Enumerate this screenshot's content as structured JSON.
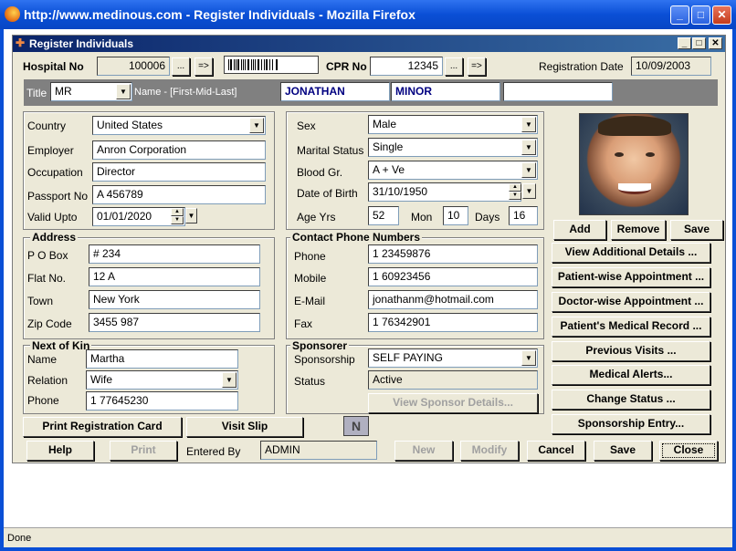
{
  "browser": {
    "title": "http://www.medinous.com - Register Individuals - Mozilla Firefox",
    "minimize": "_",
    "maximize": "□",
    "close": "✕",
    "status": "Done"
  },
  "dialog": {
    "title": "Register Individuals",
    "minimize": "_",
    "maximize": "□",
    "close": "✕"
  },
  "header": {
    "hospital_no_label": "Hospital No",
    "hospital_no": "100006",
    "browse_btn": "...",
    "go_btn": "=>",
    "cpr_no_label": "CPR No",
    "cpr_no": "12345",
    "registration_date_label": "Registration Date",
    "registration_date": "10/09/2003"
  },
  "name_band": {
    "title_label": "Title",
    "title_value": "MR",
    "name_label": "Name - [First-Mid-Last]",
    "first": "JONATHAN",
    "middle": "MINOR",
    "last": ""
  },
  "personal": {
    "country_label": "Country",
    "country": "United States",
    "employer_label": "Employer",
    "employer": "Anron Corporation",
    "occupation_label": "Occupation",
    "occupation": "Director",
    "passport_label": "Passport No",
    "passport": "A 456789",
    "valid_upto_label": "Valid Upto",
    "valid_upto": "01/01/2020"
  },
  "demographics": {
    "sex_label": "Sex",
    "sex": "Male",
    "marital_label": "Marital Status",
    "marital": "Single",
    "blood_label": "Blood Gr.",
    "blood": "A + Ve",
    "dob_label": "Date of Birth",
    "dob": "31/10/1950",
    "age_label": "Age Yrs",
    "age_yrs": "52",
    "mon_label": "Mon",
    "mon": "10",
    "days_label": "Days",
    "days": "16"
  },
  "photo_buttons": {
    "add": "Add",
    "remove": "Remove",
    "save": "Save"
  },
  "address": {
    "title": "Address",
    "pobox_label": "P O Box",
    "pobox": "# 234",
    "flat_label": "Flat No.",
    "flat": "12 A",
    "town_label": "Town",
    "town": "New York",
    "zip_label": "Zip Code",
    "zip": "3455 987"
  },
  "contact": {
    "title": "Contact Phone Numbers",
    "phone_label": "Phone",
    "phone": "1 23459876",
    "mobile_label": "Mobile",
    "mobile": "1 60923456",
    "email_label": "E-Mail",
    "email": "jonathanm@hotmail.com",
    "fax_label": "Fax",
    "fax": "1 76342901"
  },
  "kin": {
    "title": "Next of Kin",
    "name_label": "Name",
    "name": "Martha",
    "relation_label": "Relation",
    "relation": "Wife",
    "phone_label": "Phone",
    "phone": "1 77645230"
  },
  "sponsor": {
    "title": "Sponsorer",
    "sponsorship_label": "Sponsorship",
    "sponsorship": "SELF PAYING",
    "status_label": "Status",
    "status": "Active",
    "view_details": "View Sponsor Details..."
  },
  "side_actions": [
    "View Additional Details ...",
    "Patient-wise Appointment ...",
    "Doctor-wise Appointment ...",
    "Patient's Medical Record ...",
    "Previous Visits ...",
    "Medical Alerts...",
    "Change Status ...",
    "Sponsorship Entry..."
  ],
  "print_row": {
    "print_card": "Print Registration Card",
    "visit_slip": "Visit Slip",
    "notes_icon": "N"
  },
  "footer": {
    "help": "Help",
    "print": "Print",
    "entered_by_label": "Entered By",
    "entered_by": "ADMIN",
    "new": "New",
    "modify": "Modify",
    "cancel": "Cancel",
    "save": "Save",
    "close": "Close"
  }
}
